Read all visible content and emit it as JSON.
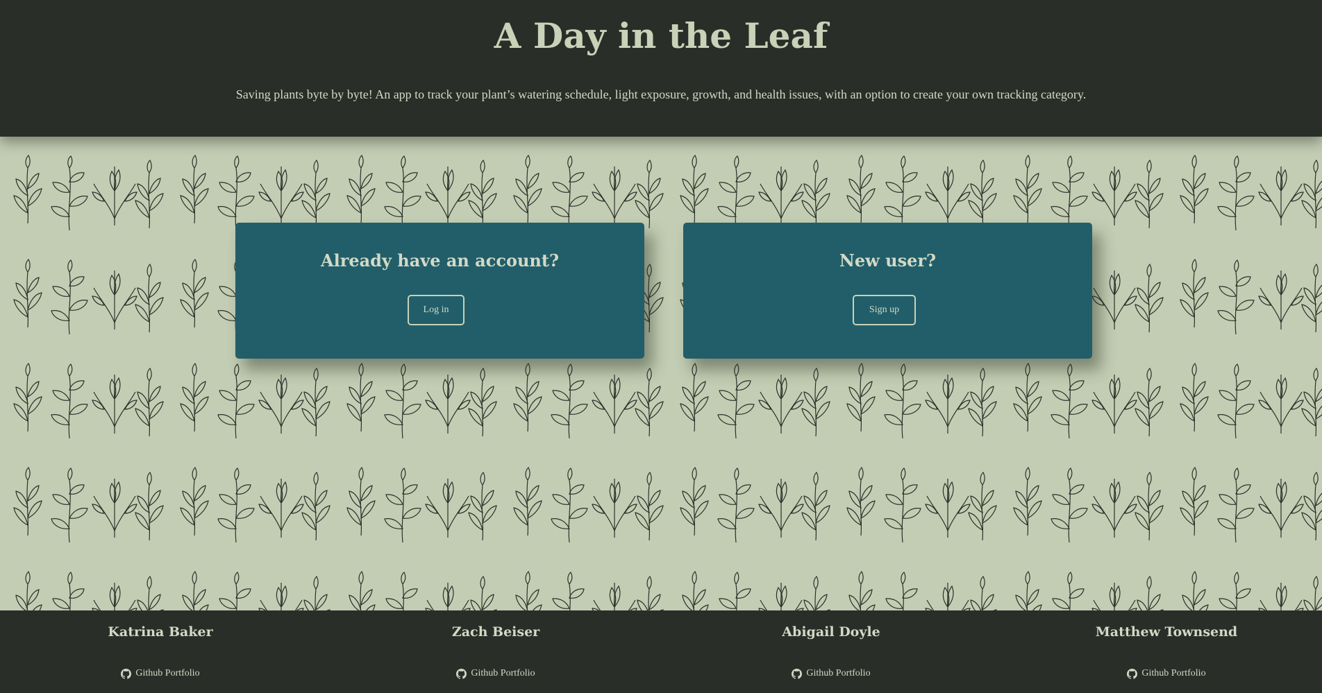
{
  "header": {
    "title": "A Day in the Leaf",
    "tagline": "Saving plants byte by byte! An app to track your plant’s watering schedule, light exposure, growth, and health issues, with an option to create your own tracking category."
  },
  "login_card": {
    "heading": "Already have an account?",
    "button_label": "Log in"
  },
  "signup_card": {
    "heading": "New user?",
    "button_label": "Sign up"
  },
  "footer": {
    "members": [
      {
        "name": "Katrina Baker",
        "link_label": "Github Portfolio",
        "icon": "github-icon"
      },
      {
        "name": "Zach Beiser",
        "link_label": "Github Portfolio",
        "icon": "github-icon"
      },
      {
        "name": "Abigail Doyle",
        "link_label": "Github Portfolio",
        "icon": "github-icon"
      },
      {
        "name": "Matthew Townsend",
        "link_label": "Github Portfolio",
        "icon": "github-icon"
      }
    ]
  },
  "colors": {
    "header_bg": "#2a2e28",
    "pattern_bg": "#c3cdb3",
    "card_bg": "#215e69",
    "text_light": "#d3d9c6",
    "leaf_line": "#2b2f2a"
  }
}
